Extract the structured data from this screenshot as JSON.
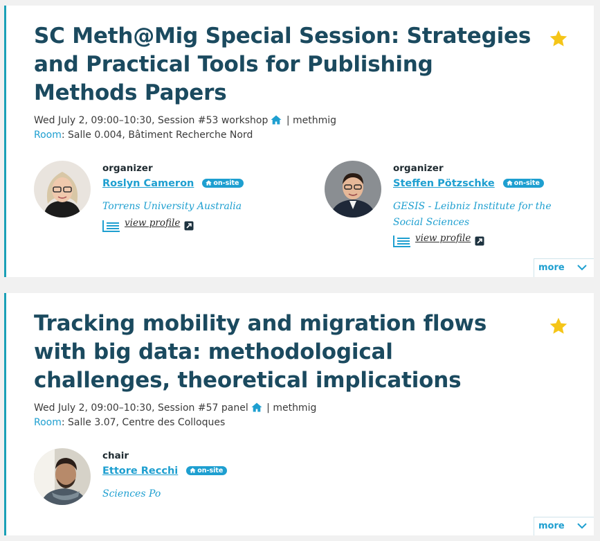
{
  "sessions": [
    {
      "title": "SC Meth@Mig Special Session: Strategies and Practical Tools for Publishing Methods Papers",
      "meta": "Wed July 2, 09:00–10:30, Session #53 workshop",
      "meta_tail": "| methmig",
      "room_label": "Room",
      "room_value": ": Salle 0.004, Bâtiment Recherche Nord",
      "more_label": "more",
      "people": [
        {
          "role": "organizer",
          "name": "Roslyn Cameron",
          "badge": "on-site",
          "affiliation": "Torrens University Australia",
          "profile_label": "view profile"
        },
        {
          "role": "organizer",
          "name": "Steffen Pötzschke",
          "badge": "on-site",
          "affiliation": "GESIS - Leibniz Institute for the Social Sciences",
          "profile_label": "view profile"
        }
      ]
    },
    {
      "title": "Tracking mobility and migration flows with big data: methodological challenges, theoretical implications",
      "meta": "Wed July 2, 09:00–10:30, Session #57 panel",
      "meta_tail": "| methmig",
      "room_label": "Room",
      "room_value": ": Salle 3.07, Centre des Colloques",
      "more_label": "more",
      "people": [
        {
          "role": "chair",
          "name": "Ettore Recchi",
          "badge": "on-site",
          "affiliation": "Sciences Po"
        }
      ]
    }
  ],
  "colors": {
    "accent": "#1e9fd0",
    "title": "#1b4a5f",
    "star": "#f5c518",
    "border": "#1aa0b7"
  }
}
